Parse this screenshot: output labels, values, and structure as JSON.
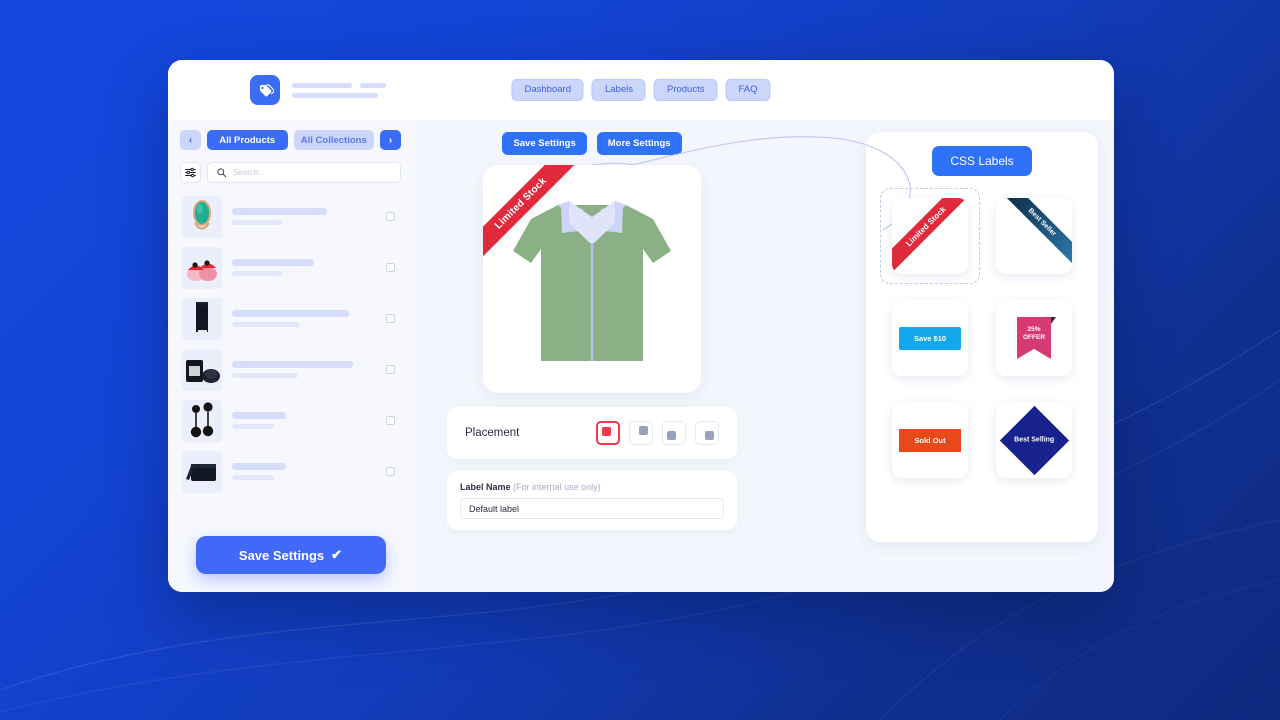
{
  "header": {
    "logo_icon": "tag-icon",
    "nav": [
      {
        "label": "Dashboard"
      },
      {
        "label": "Labels"
      },
      {
        "label": "Products"
      },
      {
        "label": "FAQ"
      }
    ]
  },
  "sidebar": {
    "prev_arrow": "‹",
    "next_arrow": "›",
    "tabs": [
      {
        "label": "All Products",
        "active": true
      },
      {
        "label": "All Collections",
        "active": false
      }
    ],
    "filter_icon": "sliders-icon",
    "search": {
      "placeholder": "Search...",
      "value": ""
    },
    "products": [
      {
        "thumb": "ring"
      },
      {
        "thumb": "sandals"
      },
      {
        "thumb": "bottle"
      },
      {
        "thumb": "candle"
      },
      {
        "thumb": "earrings"
      },
      {
        "thumb": "wallet"
      }
    ],
    "save_button": "Save Settings",
    "save_button_icon": "check-icon"
  },
  "main": {
    "actions": [
      {
        "label": "Save Settings"
      },
      {
        "label": "More Settings"
      }
    ],
    "preview": {
      "ribbon_text": "Limited Stock",
      "ribbon_color": "#e02a3c",
      "product_image": "green-shirt"
    },
    "placement": {
      "label": "Placement",
      "options": [
        {
          "position": "top-left",
          "selected": true
        },
        {
          "position": "top-right",
          "selected": false
        },
        {
          "position": "bottom-left",
          "selected": false
        },
        {
          "position": "bottom-right",
          "selected": false
        }
      ]
    },
    "label_name": {
      "label": "Label Name",
      "hint": "(For internal use only)",
      "value": "Default label",
      "placeholder": "Default label"
    }
  },
  "right_panel": {
    "title": "CSS Labels",
    "labels": [
      {
        "name": "Limited Stock",
        "style": "corner-ribbon-red",
        "selected": true
      },
      {
        "name": "Best Seller",
        "style": "corner-ribbon-blue-gradient",
        "selected": false
      },
      {
        "name": "Save $10",
        "style": "flat-badge-blue",
        "selected": false
      },
      {
        "name": "25%\nOFFER",
        "line1": "25%",
        "line2": "OFFER",
        "style": "ribbon-pink",
        "selected": false
      },
      {
        "name": "Sold Out",
        "style": "flat-badge-orange",
        "selected": false
      },
      {
        "name": "Best Selling",
        "style": "diamond-navy",
        "selected": false
      }
    ]
  },
  "colors": {
    "primary": "#3b6cf6",
    "accent_blue": "#2f72f8",
    "ribbon_red": "#e02a3c",
    "badge_blue": "#14a7ec",
    "badge_orange": "#e8491a",
    "ribbon_pink": "#d63a73",
    "diamond_navy": "#17228c",
    "background": "#1344d4"
  }
}
